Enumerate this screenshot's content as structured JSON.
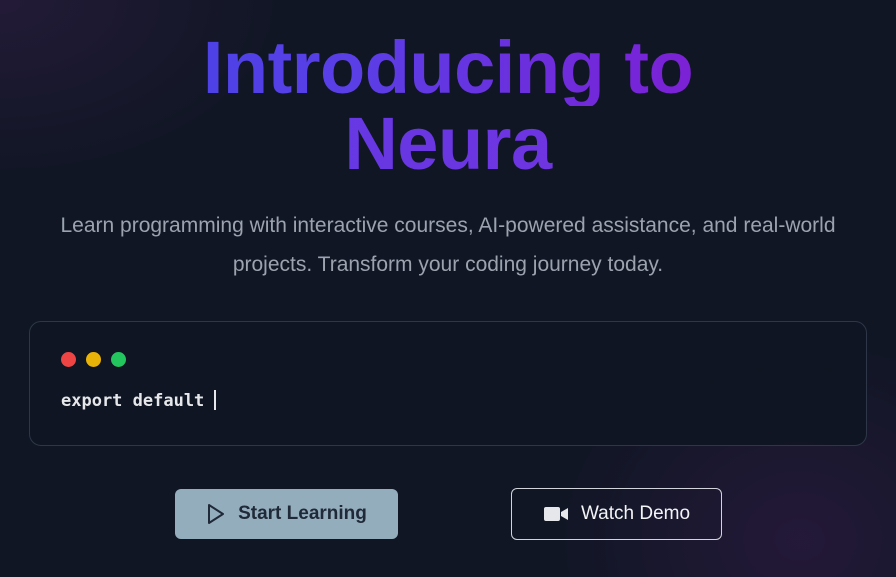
{
  "hero": {
    "title_line1": "Introducing to",
    "title_line2": "Neura",
    "subtitle_line1": "Learn programming with interactive courses, AI-powered assistance, and real-world",
    "subtitle_line2": "projects. Transform your coding journey today."
  },
  "code_window": {
    "window_controls": [
      "red-dot",
      "yellow-dot",
      "green-dot"
    ],
    "code_text": "export default"
  },
  "actions": {
    "primary": {
      "label": "Start Learning",
      "icon": "play-icon"
    },
    "secondary": {
      "label": "Watch Demo",
      "icon": "video-camera-icon"
    }
  },
  "colors": {
    "background": "#101624",
    "title_gradient_start": "#3b46e6",
    "title_gradient_end": "#8a1fd0",
    "primary_button": "#94adbd",
    "dot_red": "#ef4444",
    "dot_yellow": "#eab308",
    "dot_green": "#22c55e"
  }
}
